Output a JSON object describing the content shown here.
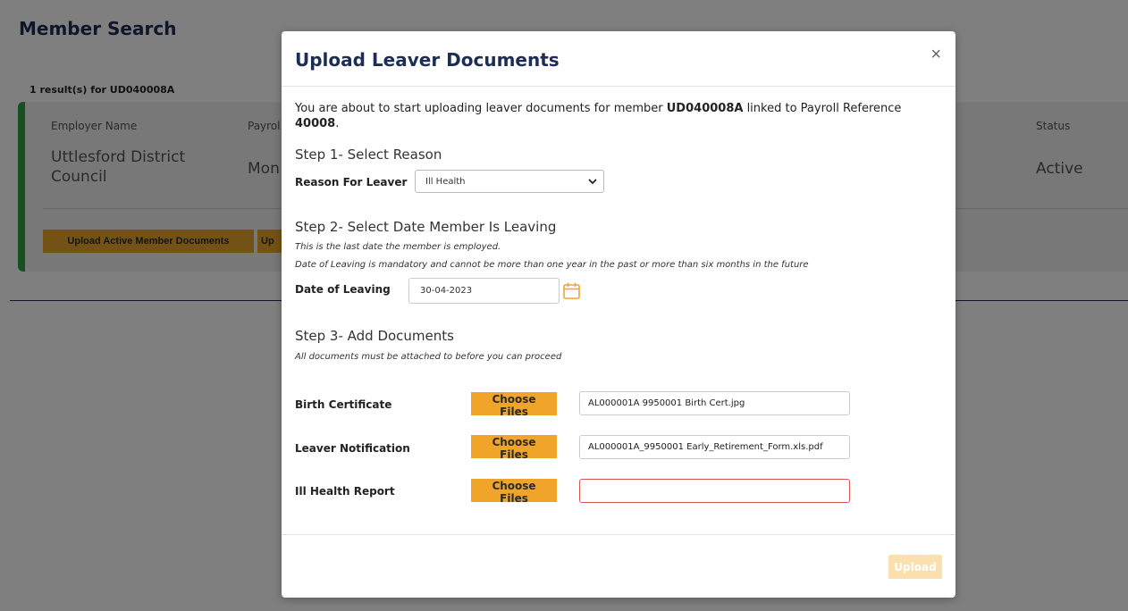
{
  "background": {
    "page_title": "Member Search",
    "result_count": "1 result(s) for UD040008A",
    "columns": {
      "employer": "Employer Name",
      "payroll": "Payrol",
      "status": "Status"
    },
    "row": {
      "employer_name": "Uttlesford District Council",
      "payroll_value": "Mon",
      "status": "Active"
    },
    "buttons": {
      "upload_active": "Upload Active Member Documents",
      "upload_other": "Up"
    }
  },
  "modal": {
    "title": "Upload Leaver Documents",
    "close_label": "×",
    "intro": {
      "prefix": "You are about to start uploading leaver documents for member ",
      "member": "UD040008A",
      "middle": " linked to Payroll Reference ",
      "payroll_ref": "40008",
      "suffix": "."
    },
    "step1": {
      "heading": "Step 1- Select Reason",
      "label": "Reason For Leaver",
      "selected": "Ill Health"
    },
    "step2": {
      "heading": "Step 2- Select Date Member Is Leaving",
      "hint1": "This is the last date the member is employed.",
      "hint2": "Date of Leaving is mandatory and cannot be more than one year in the past or more than six months in the future",
      "label": "Date of Leaving",
      "value": "30-04-2023"
    },
    "step3": {
      "heading": "Step 3- Add Documents",
      "hint": "All documents must be attached to before you can proceed",
      "rows": [
        {
          "label": "Birth Certificate",
          "button": "Choose Files",
          "file": "AL000001A 9950001 Birth Cert.jpg"
        },
        {
          "label": "Leaver Notification",
          "button": "Choose Files",
          "file": "AL000001A_9950001 Early_Retirement_Form.xls.pdf"
        },
        {
          "label": "Ill Health Report",
          "button": "Choose Files",
          "file": ""
        }
      ]
    },
    "upload_label": "Upload"
  },
  "colors": {
    "navy": "#1e2d55",
    "accent": "#f0a52a",
    "green": "#2e9e45",
    "error": "#d9534f"
  },
  "icons": [
    "close-icon",
    "chevron-down-icon",
    "calendar-icon"
  ]
}
